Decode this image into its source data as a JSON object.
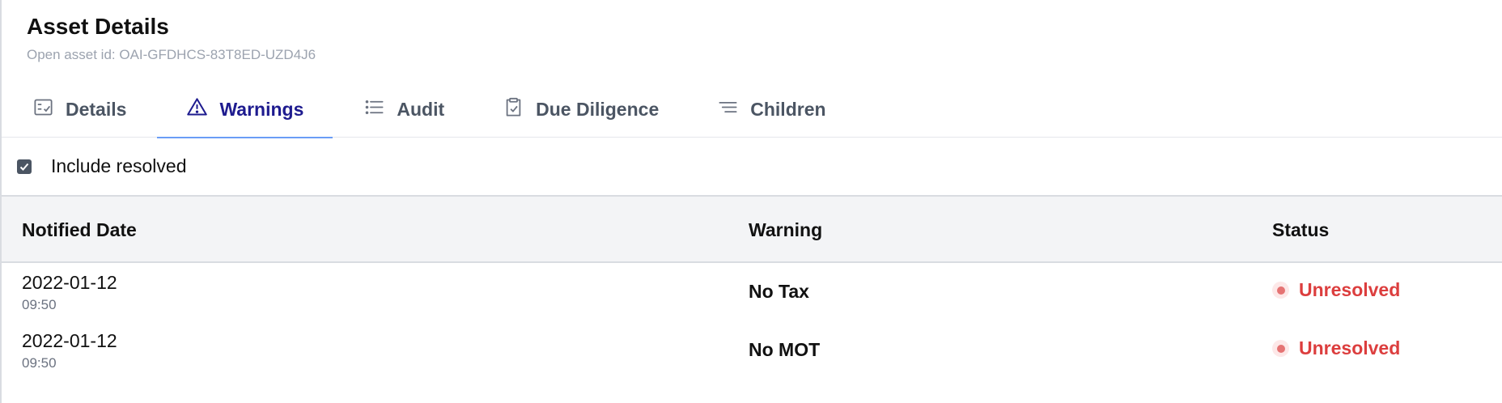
{
  "header": {
    "title": "Asset Details",
    "subtitle": "Open asset id: OAI-GFDHCS-83T8ED-UZD4J6"
  },
  "tabs": [
    {
      "label": "Details",
      "icon": "checklist-icon"
    },
    {
      "label": "Warnings",
      "icon": "warning-triangle-icon",
      "active": true
    },
    {
      "label": "Audit",
      "icon": "list-icon"
    },
    {
      "label": "Due Diligence",
      "icon": "clipboard-check-icon"
    },
    {
      "label": "Children",
      "icon": "lines-icon"
    }
  ],
  "filter": {
    "include_resolved_label": "Include resolved",
    "include_resolved_checked": true
  },
  "table": {
    "headers": [
      "Notified Date",
      "Warning",
      "Status"
    ],
    "rows": [
      {
        "date": "2022-01-12",
        "time": "09:50",
        "warning": "No Tax",
        "status": "Unresolved"
      },
      {
        "date": "2022-01-12",
        "time": "09:50",
        "warning": "No MOT",
        "status": "Unresolved"
      }
    ]
  },
  "colors": {
    "active_tab": "#1e1b8f",
    "active_underline": "#6a9df6",
    "status_unresolved": "#dc3e3e",
    "header_bg": "#f3f4f6"
  }
}
